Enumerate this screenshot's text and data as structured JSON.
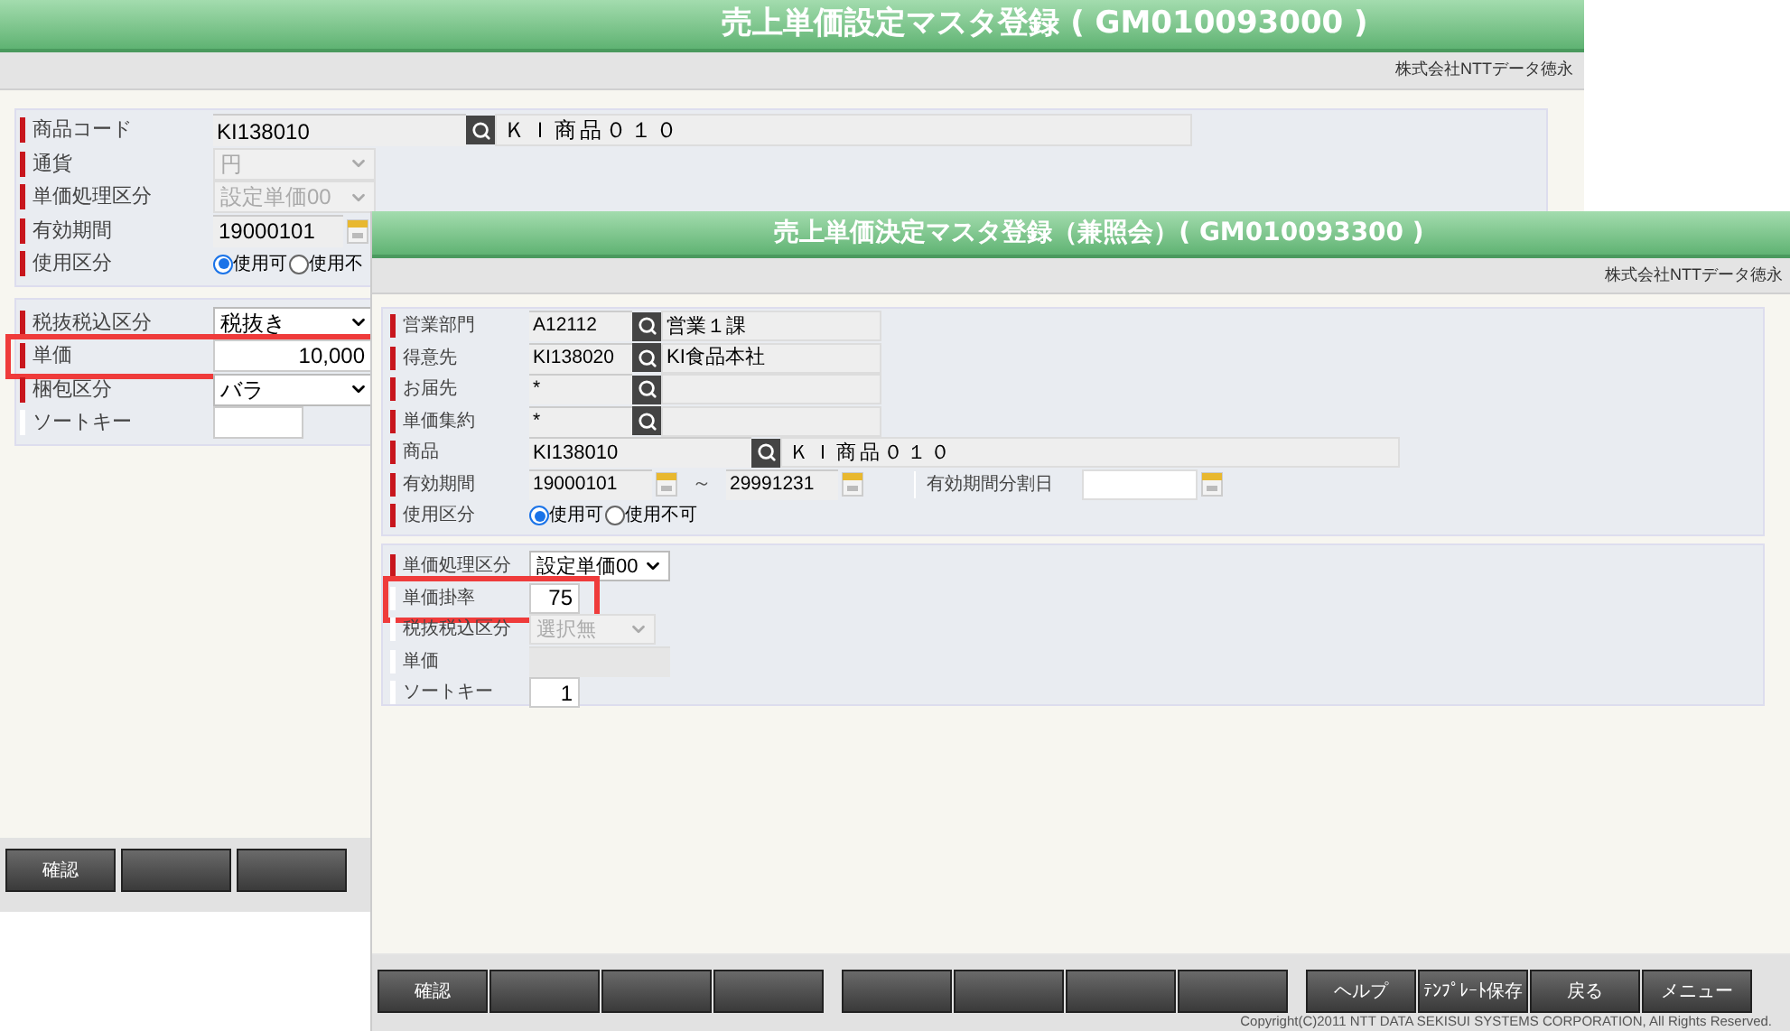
{
  "windows": [
    {
      "title": "売上単価設定マスタ登録 ( GM010093000 )",
      "company": "株式会社NTTデータ徳永",
      "panels": [
        [
          {
            "label": "商品コード",
            "required": true,
            "kind": "lookup_wide",
            "code": "KI138010",
            "name": "ＫＩ商品０１０"
          },
          {
            "label": "通貨",
            "required": true,
            "kind": "select",
            "value": "円",
            "disabled": true
          },
          {
            "label": "単価処理区分",
            "required": true,
            "kind": "select",
            "value": "設定単価00",
            "disabled": true
          },
          {
            "label": "有効期間",
            "required": true,
            "kind": "date",
            "value": "19000101"
          },
          {
            "label": "使用区分",
            "required": true,
            "kind": "radio",
            "options": [
              {
                "label": "使用可",
                "selected": true
              },
              {
                "label": "使用不",
                "selected": false
              }
            ]
          }
        ],
        [
          {
            "label": "税抜税込区分",
            "required": true,
            "kind": "select",
            "value": "税抜き",
            "disabled": false
          },
          {
            "label": "単価",
            "required": true,
            "kind": "number",
            "value": "10,000",
            "highlighted": true
          },
          {
            "label": "梱包区分",
            "required": true,
            "kind": "select",
            "value": "バラ",
            "disabled": false
          },
          {
            "label": "ソートキー",
            "required": false,
            "kind": "number"
          }
        ]
      ],
      "buttons": [
        [
          {
            "kind": "labeled",
            "label": "確認"
          },
          {
            "kind": "blank"
          },
          {
            "kind": "blank"
          }
        ]
      ]
    },
    {
      "title": "売上単価決定マスタ登録（兼照会）( GM010093300 )",
      "company": "株式会社NTTデータ徳永",
      "panels": [
        [
          {
            "label": "営業部門",
            "required": true,
            "kind": "lookup",
            "code": "A12112",
            "name": "営業１課"
          },
          {
            "label": "得意先",
            "required": true,
            "kind": "lookup",
            "code": "KI138020",
            "name": "KI食品本社"
          },
          {
            "label": "お届先",
            "required": true,
            "kind": "lookup",
            "code": "*"
          },
          {
            "label": "単価集約",
            "required": true,
            "kind": "lookup",
            "code": "*"
          },
          {
            "label": "商品",
            "required": true,
            "kind": "lookup_wide",
            "code": "KI138010",
            "name": "ＫＩ商品０１０"
          },
          {
            "label": "有効期間",
            "required": true,
            "kind": "range",
            "from": "19000101",
            "sep": "～",
            "to": "29991231",
            "split_label": "有効期間分割日"
          },
          {
            "label": "使用区分",
            "required": true,
            "kind": "radio",
            "options": [
              {
                "label": "使用可",
                "selected": true
              },
              {
                "label": "使用不可",
                "selected": false
              }
            ]
          }
        ],
        [
          {
            "label": "単価処理区分",
            "required": true,
            "kind": "select",
            "value": "設定単価00",
            "disabled": false
          },
          {
            "label": "単価掛率",
            "required": false,
            "kind": "number",
            "value": "75",
            "highlighted": true
          },
          {
            "label": "税抜税込区分",
            "required": false,
            "kind": "select",
            "value": "選択無",
            "disabled": true
          },
          {
            "label": "単価",
            "required": false,
            "kind": "readonly"
          },
          {
            "label": "ソートキー",
            "required": false,
            "kind": "number",
            "value": "1"
          }
        ]
      ],
      "buttons": [
        [
          {
            "kind": "labeled",
            "label": "確認"
          },
          {
            "kind": "blank"
          },
          {
            "kind": "blank"
          },
          {
            "kind": "blank"
          }
        ],
        [
          {
            "kind": "blank"
          },
          {
            "kind": "blank"
          },
          {
            "kind": "blank"
          },
          {
            "kind": "blank"
          }
        ],
        [
          {
            "kind": "labeled",
            "label": "ヘルプ"
          },
          {
            "kind": "labeled",
            "label": "ﾃﾝﾌﾟﾚｰﾄ保存"
          },
          {
            "kind": "labeled",
            "label": "戻る"
          },
          {
            "kind": "labeled",
            "label": "メニュー"
          }
        ]
      ],
      "copyright": "Copyright(C)2011 NTT DATA SEKISUI SYSTEMS CORPORATION, All Rights Reserved."
    }
  ]
}
